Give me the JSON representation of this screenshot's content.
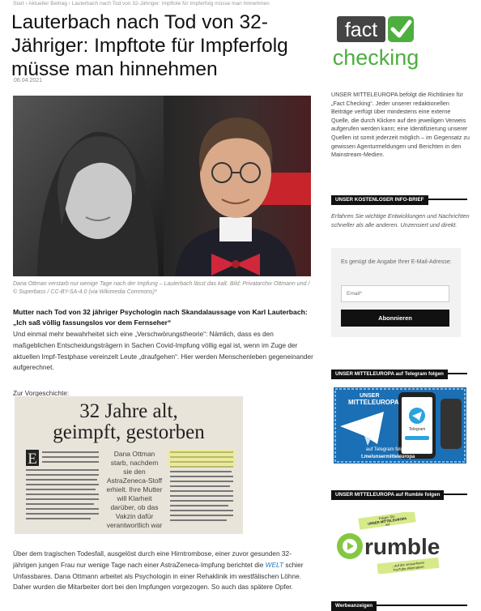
{
  "breadcrumb": "Start  ›  Aktueller Beitrag  ›  Lauterbach nach Tod von 32-Jähriger: Impftote für Impferfolg müsse man hinnehmen",
  "article": {
    "title": "Lauterbach nach Tod von 32-Jähriger: Impftote für Impferfolg müsse man hinnehmen",
    "date": "06.04.2021",
    "caption": "Dana Ottman verstarb nur wenige Tage nach der Impfung – Lauterbach lässt das kalt. Bild: Privatarchiv Ottmann und /© Superbass / CC-BY-SA-4.0 (via Wikimedia Commons)*",
    "lead": "Mutter nach Tod von 32 jähriger Psychologin nach Skandalaussage von Karl Lauterbach: „Ich saß völlig fassungslos vor dem Fernseher“",
    "p1": "Und einmal mehr bewahrheitet sich eine „Verschwörungstheorie“: Nämlich, dass es den maßgeblichen Entscheidungsträgern in Sachen Covid-Impfung völlig egal ist, wenn im Zuge der aktuellen Impf-Testphase vereinzelt Leute „draufgehen“. Hier werden Menschenleben gegeneinander aufgerechnet.",
    "prev": "Zur Vorgeschichte:",
    "clip": {
      "headline1": "32 Jahre alt,",
      "headline2": "geimpft, gestorben",
      "sub1": "Dana Ottman",
      "sub2": "starb, nachdem",
      "sub3": "sie den",
      "sub4": "AstraZeneca-Stoff",
      "sub5": "erhielt. Ihre Mutter",
      "sub6": "will Klarheit",
      "sub7": "darüber, ob das",
      "sub8": "Vakzin dafür",
      "sub9": "verantwortlich war",
      "drop": "E"
    },
    "p2_a": "Über dem tragischen Todesfall, ausgelöst durch eine Hirntrombose, einer zuvor gesunden 32-jährigen jungen Frau nur wenige Tage nach einer AstraZeneca-Impfung berichtet die ",
    "p2_link": "WELT",
    "p2_b": " schier Unfassbares. Dana Ottmann arbeitet als Psychologin in einer Rehaklinik im westfälischen Löhne. Daher wurden die Mitarbeiter dort bei den Impfungen vorgezogen. So auch das spätere Opfer."
  },
  "sidebar": {
    "fc1": "fact",
    "fc2": "checking",
    "fact_text": "UNSER MITTELEUROPA befolgt die Richtlinien für „Fact Checking“. Jeder unserer redaktionellen Beiträge verfügt über mindestens eine externe Quelle, die durch Klicken auf den jeweiligen Verweis aufgerufen werden kann; eine Identifizierung unserer Quellen ist somit jederzeit möglich – im Gegensatz zu gewissen Agenturmeldungen und Berichten in den Mainstream-Medien.",
    "h1": "UNSER KOSTENLOSER INFO-BRIEF",
    "nl_text": "Erfahren Sie wichtige Entwicklungen und Nachrichten schneller als alle anderen. Unzensiert und direkt.",
    "nl_label": "Es genügt die Angabe Ihrer E-Mail-Adresse:",
    "email_placeholder": "Email*",
    "subscribe": "Abonnieren",
    "h2": "UNSER MITTELEUROPA auf Telegram folgen",
    "tg_brand1": "UNSER",
    "tg_brand2": "MITTELEUROPA",
    "tg_app": "Telegram",
    "tg_cap1": "auf Telegram folgen",
    "tg_cap2": "t.me/unsermitteleuropa",
    "h3": "UNSER MITTELEUROPA auf Rumble folgen",
    "rb_top1": "Folgen Sie",
    "rb_top2": "UNSER MITTELEUROPA",
    "rb_top3": "auf",
    "rb_word": "rumble",
    "rb_bot1": "...auf der zensurfreien",
    "rb_bot2": "YouTube-Alternative!",
    "h4": "Werbeanzeigen"
  }
}
